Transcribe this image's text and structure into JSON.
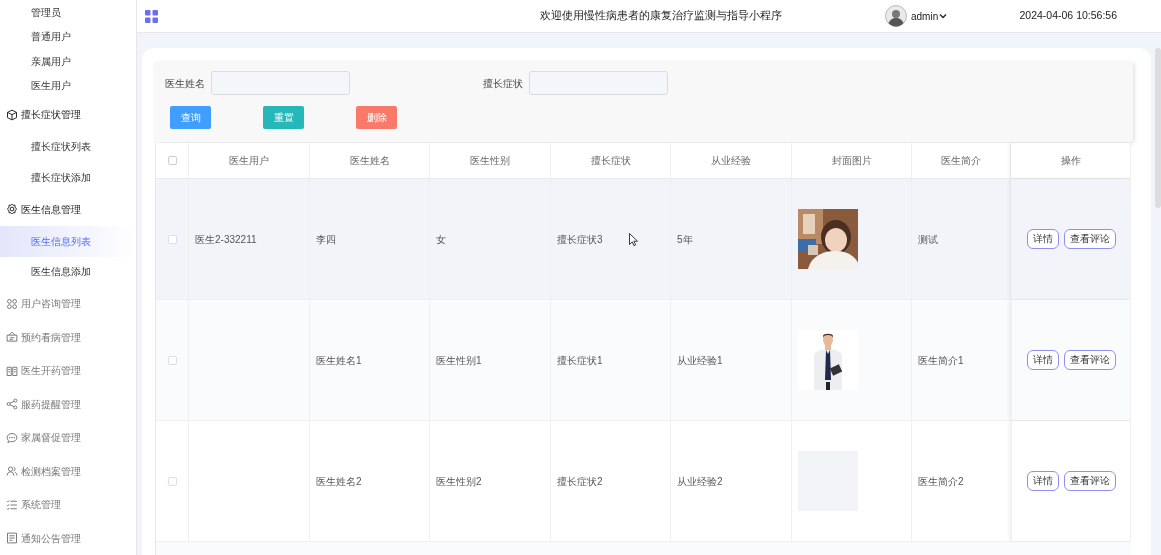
{
  "sidebar": {
    "loose_items": [
      {
        "label": "管理员",
        "selected": false
      },
      {
        "label": "普通用户",
        "selected": false
      },
      {
        "label": "亲属用户",
        "selected": false
      },
      {
        "label": "医生用户",
        "selected": false
      }
    ],
    "groups": [
      {
        "label": "擅长症状管理",
        "expanded": true,
        "children": [
          {
            "label": "擅长症状列表",
            "selected": false
          },
          {
            "label": "擅长症状添加",
            "selected": false
          }
        ]
      },
      {
        "label": "医生信息管理",
        "expanded": true,
        "children": [
          {
            "label": "医生信息列表",
            "selected": true
          },
          {
            "label": "医生信息添加",
            "selected": false
          }
        ]
      },
      {
        "label": "用户咨询管理",
        "expanded": false
      },
      {
        "label": "预约看病管理",
        "expanded": false
      },
      {
        "label": "医生开药管理",
        "expanded": false
      },
      {
        "label": "服药提醒管理",
        "expanded": false
      },
      {
        "label": "家属督促管理",
        "expanded": false
      },
      {
        "label": "检测档案管理",
        "expanded": false
      },
      {
        "label": "系统管理",
        "expanded": false
      },
      {
        "label": "通知公告管理",
        "expanded": false
      }
    ]
  },
  "header": {
    "title": "欢迎使用慢性病患者的康复治疗监测与指导小程序",
    "user": "admin",
    "datetime": "2024-04-06 10:56:56"
  },
  "search": {
    "fields": [
      {
        "label": "医生姓名"
      },
      {
        "label": "擅长症状"
      }
    ],
    "buttons": [
      {
        "label": "查询",
        "color": "#409eff"
      },
      {
        "label": "重置",
        "color": "#26b8b8"
      },
      {
        "label": "删除",
        "color": "#fa7a6a"
      }
    ]
  },
  "table": {
    "all_checked": false,
    "columns": [
      "医生用户",
      "医生姓名",
      "医生性别",
      "擅长症状",
      "从业经验",
      "封面图片",
      "医生简介",
      "操作"
    ],
    "rows": [
      {
        "checked": false,
        "hovered": true,
        "cells": [
          "医生2-332211",
          "李四",
          "女",
          "擅长症状3",
          "5年"
        ],
        "cover": {
          "kind": "picture"
        },
        "intro": "测试",
        "actions": [
          "详情",
          "查看评论"
        ]
      },
      {
        "checked": false,
        "hovered": false,
        "cells": [
          "",
          "医生姓名1",
          "医生性别1",
          "擅长症状1",
          "从业经验1"
        ],
        "cover": {
          "kind": "picture"
        },
        "intro": "医生简介1",
        "actions": [
          "详情",
          "查看评论"
        ]
      },
      {
        "checked": false,
        "hovered": false,
        "cells": [
          "",
          "医生姓名2",
          "医生性别2",
          "擅长症状2",
          "从业经验2"
        ],
        "cover": {
          "kind": "empty"
        },
        "intro": "医生简介2",
        "actions": [
          "详情",
          "查看评论"
        ]
      }
    ]
  }
}
